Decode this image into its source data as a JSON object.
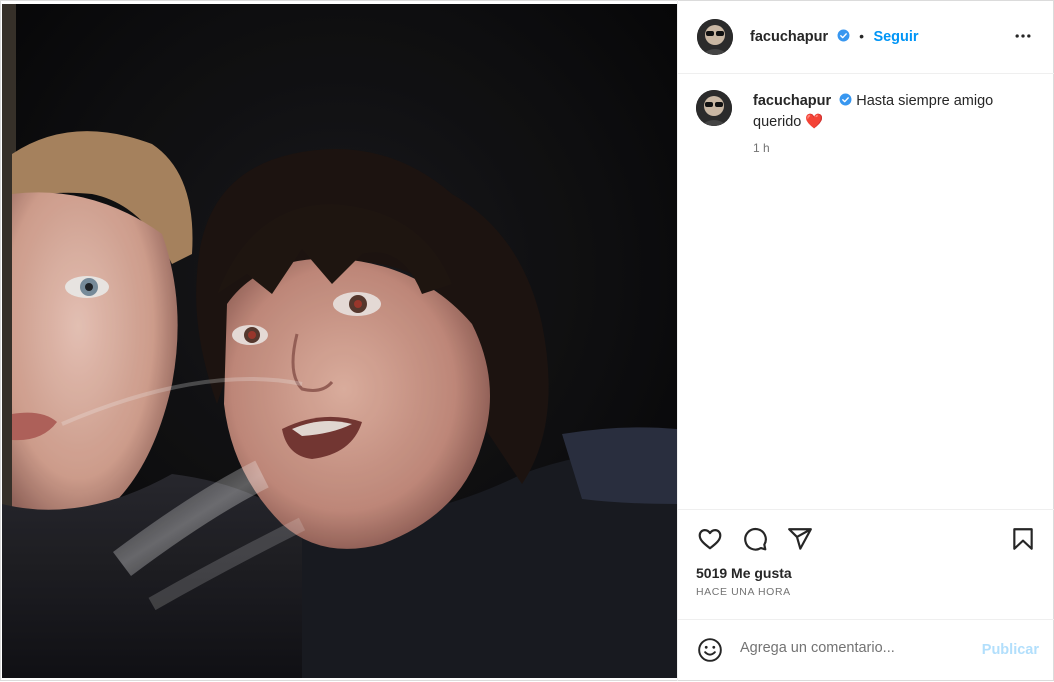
{
  "post": {
    "image_alt": "Foto antigua de dos jóvenes",
    "author": {
      "username": "facuchapur",
      "verified": true
    },
    "follow_label": "Seguir",
    "separator": "•",
    "caption": {
      "username": "facuchapur",
      "text": "Hasta siempre amigo querido",
      "emoji": "❤️",
      "time": "1 h"
    },
    "likes": "5019 Me gusta",
    "posted_ago": "HACE UNA HORA",
    "comment": {
      "placeholder": "Agrega un comentario...",
      "publish_label": "Publicar"
    }
  },
  "colors": {
    "accent": "#0095f6",
    "publish_disabled": "#b2dffc",
    "verified": "#3897f0",
    "heart": "#ed4956"
  },
  "icons": [
    "more-options-icon",
    "heart-icon",
    "comment-icon",
    "share-icon",
    "bookmark-icon",
    "emoji-icon",
    "verified-icon"
  ]
}
